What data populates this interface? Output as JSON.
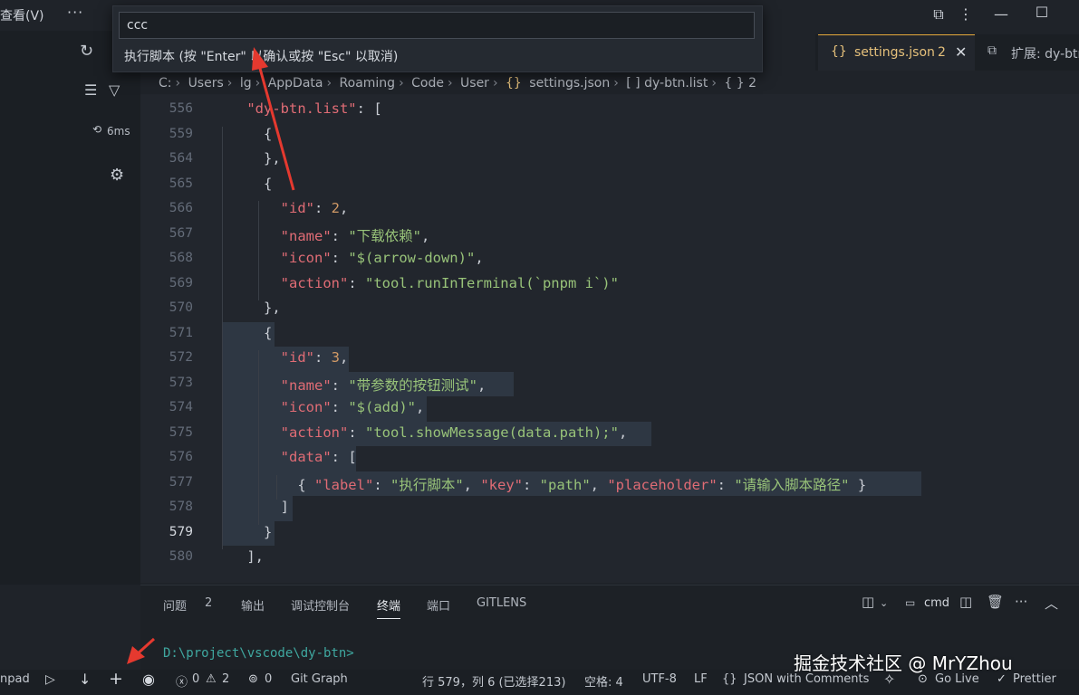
{
  "menu": {
    "view_label": "查看(V)",
    "more_label": "···"
  },
  "window": {
    "restore_icon": "restore-icon",
    "min_icon": "minimize-icon",
    "max_icon": "maximize-icon",
    "close_icon": "close-icon"
  },
  "sidebar": {
    "timer": "6ms"
  },
  "tabs": [
    {
      "label": "settings.json",
      "count": "2"
    },
    {
      "label": "扩展: dy-btn"
    }
  ],
  "breadcrumb": [
    "C:",
    "Users",
    "lg",
    "AppData",
    "Roaming",
    "Code",
    "User",
    "settings.json",
    "[ ] dy-btn.list",
    "{ } 2"
  ],
  "quick_input": {
    "value": "ccc",
    "message": "执行脚本 (按 \"Enter\" 以确认或按 \"Esc\" 以取消)"
  },
  "editor": {
    "active_line": "579",
    "lines": [
      {
        "no": "556",
        "tokens": [
          {
            "t": "    "
          },
          {
            "t": "\"dy-btn.list\"",
            "c": "k"
          },
          {
            "t": ": ["
          }
        ]
      },
      {
        "no": "559",
        "tokens": [
          {
            "t": "      {"
          }
        ]
      },
      {
        "no": "564",
        "tokens": [
          {
            "t": "      },"
          }
        ]
      },
      {
        "no": "565",
        "tokens": [
          {
            "t": "      {"
          }
        ]
      },
      {
        "no": "566",
        "tokens": [
          {
            "t": "        "
          },
          {
            "t": "\"id\"",
            "c": "k"
          },
          {
            "t": ": "
          },
          {
            "t": "2",
            "c": "n"
          },
          {
            "t": ","
          }
        ]
      },
      {
        "no": "567",
        "tokens": [
          {
            "t": "        "
          },
          {
            "t": "\"name\"",
            "c": "k"
          },
          {
            "t": ": "
          },
          {
            "t": "\"下载依赖\"",
            "c": "s"
          },
          {
            "t": ","
          }
        ]
      },
      {
        "no": "568",
        "tokens": [
          {
            "t": "        "
          },
          {
            "t": "\"icon\"",
            "c": "k"
          },
          {
            "t": ": "
          },
          {
            "t": "\"$(arrow-down)\"",
            "c": "s"
          },
          {
            "t": ","
          }
        ]
      },
      {
        "no": "569",
        "tokens": [
          {
            "t": "        "
          },
          {
            "t": "\"action\"",
            "c": "k"
          },
          {
            "t": ": "
          },
          {
            "t": "\"tool.runInTerminal(`pnpm i`)\"",
            "c": "s"
          }
        ]
      },
      {
        "no": "570",
        "tokens": [
          {
            "t": "      },"
          }
        ]
      },
      {
        "no": "571",
        "tokens": [
          {
            "t": "      {"
          }
        ]
      },
      {
        "no": "572",
        "tokens": [
          {
            "t": "        "
          },
          {
            "t": "\"id\"",
            "c": "k"
          },
          {
            "t": ": "
          },
          {
            "t": "3",
            "c": "n"
          },
          {
            "t": ","
          }
        ]
      },
      {
        "no": "573",
        "tokens": [
          {
            "t": "        "
          },
          {
            "t": "\"name\"",
            "c": "k"
          },
          {
            "t": ": "
          },
          {
            "t": "\"带参数的按钮测试\"",
            "c": "s"
          },
          {
            "t": ","
          }
        ]
      },
      {
        "no": "574",
        "tokens": [
          {
            "t": "        "
          },
          {
            "t": "\"icon\"",
            "c": "k"
          },
          {
            "t": ": "
          },
          {
            "t": "\"$(add)\"",
            "c": "s"
          },
          {
            "t": ","
          }
        ]
      },
      {
        "no": "575",
        "tokens": [
          {
            "t": "        "
          },
          {
            "t": "\"action\"",
            "c": "k"
          },
          {
            "t": ": "
          },
          {
            "t": "\"tool.showMessage(data.path);\"",
            "c": "s"
          },
          {
            "t": ","
          }
        ]
      },
      {
        "no": "576",
        "tokens": [
          {
            "t": "        "
          },
          {
            "t": "\"data\"",
            "c": "k"
          },
          {
            "t": ": ["
          }
        ]
      },
      {
        "no": "577",
        "tokens": [
          {
            "t": "          { "
          },
          {
            "t": "\"label\"",
            "c": "k"
          },
          {
            "t": ": "
          },
          {
            "t": "\"执行脚本\"",
            "c": "s"
          },
          {
            "t": ", "
          },
          {
            "t": "\"key\"",
            "c": "k"
          },
          {
            "t": ": "
          },
          {
            "t": "\"path\"",
            "c": "s"
          },
          {
            "t": ", "
          },
          {
            "t": "\"placeholder\"",
            "c": "k"
          },
          {
            "t": ": "
          },
          {
            "t": "\"请输入脚本路径\"",
            "c": "s"
          },
          {
            "t": " }"
          }
        ]
      },
      {
        "no": "578",
        "tokens": [
          {
            "t": "        ]"
          }
        ]
      },
      {
        "no": "579",
        "tokens": [
          {
            "t": "      }"
          }
        ]
      },
      {
        "no": "580",
        "tokens": [
          {
            "t": "    ],"
          }
        ]
      }
    ]
  },
  "panel": {
    "tabs": [
      "问题",
      "输出",
      "调试控制台",
      "终端",
      "端口",
      "GITLENS"
    ],
    "problems_count": "2",
    "active_tab": "终端",
    "shell": "cmd",
    "terminal_line": "D:\\project\\vscode\\dy-btn>"
  },
  "status": {
    "left_item": "npad",
    "errors": "0",
    "warnings": "2",
    "ports": "0",
    "git_graph": "Git Graph",
    "cursor": "行 579，列 6 (已选择213)",
    "spaces": "空格: 4",
    "encoding": "UTF-8",
    "eol": "LF",
    "language": "JSON with Comments",
    "go_live": "Go Live",
    "prettier": "Prettier"
  },
  "watermark": "掘金技术社区 @ MrYZhou",
  "colors": {
    "accent": "#e5a93b",
    "key": "#e06c75",
    "string": "#98c379",
    "number": "#d19a66",
    "terminal": "#3fa8a0",
    "arrow": "#e5392f"
  }
}
